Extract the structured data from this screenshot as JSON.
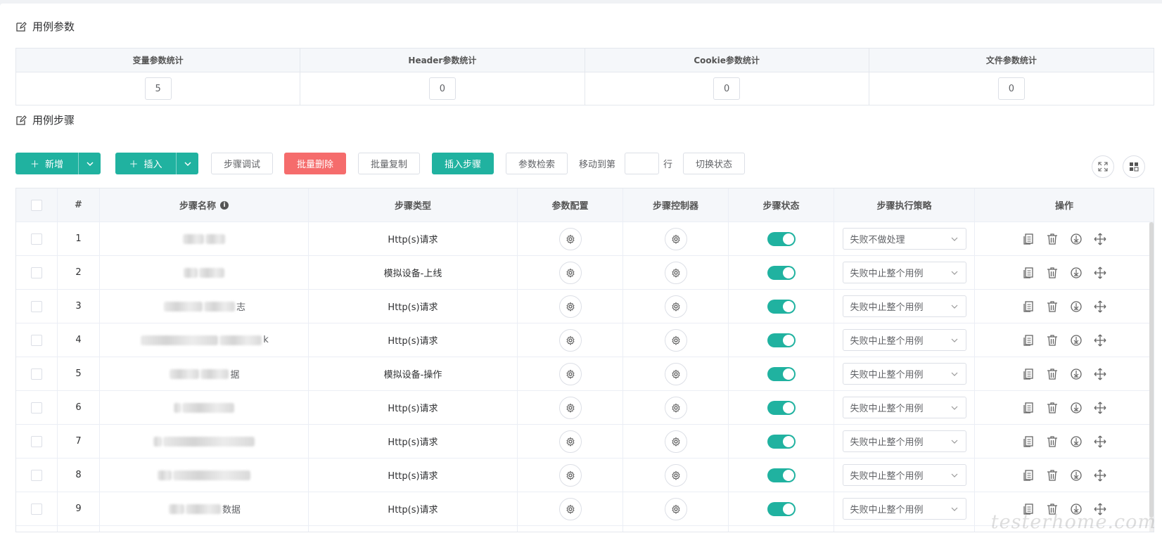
{
  "params_section": {
    "title": "用例参数"
  },
  "stats": [
    {
      "label": "变量参数统计",
      "value": "5"
    },
    {
      "label": "Header参数统计",
      "value": "0"
    },
    {
      "label": "Cookie参数统计",
      "value": "0"
    },
    {
      "label": "文件参数统计",
      "value": "0"
    }
  ],
  "steps_section": {
    "title": "用例步骤"
  },
  "toolbar": {
    "add_label": "新增",
    "insert_label": "插入",
    "debug_label": "步骤调试",
    "batch_delete_label": "批量删除",
    "batch_copy_label": "批量复制",
    "insert_step_label": "插入步骤",
    "param_search_label": "参数检索",
    "move_to_label": "移动到第",
    "row_label": "行",
    "toggle_status_label": "切换状态"
  },
  "table": {
    "headers": [
      "#",
      "步骤名称",
      "步骤类型",
      "参数配置",
      "步骤控制器",
      "步骤状态",
      "步骤执行策略",
      "操作"
    ],
    "rows": [
      {
        "index": "1",
        "name_prefix": "",
        "name_suffix": "",
        "type": "Http(s)请求",
        "enabled": true,
        "strategy": "失败不做处理"
      },
      {
        "index": "2",
        "name_prefix": "",
        "name_suffix": "",
        "type": "模拟设备-上线",
        "enabled": true,
        "strategy": "失败中止整个用例"
      },
      {
        "index": "3",
        "name_prefix": "",
        "name_suffix": "志",
        "type": "Http(s)请求",
        "enabled": true,
        "strategy": "失败中止整个用例"
      },
      {
        "index": "4",
        "name_prefix": "",
        "name_suffix": "k",
        "type": "Http(s)请求",
        "enabled": true,
        "strategy": "失败中止整个用例"
      },
      {
        "index": "5",
        "name_prefix": "",
        "name_suffix": "据",
        "type": "模拟设备-操作",
        "enabled": true,
        "strategy": "失败中止整个用例"
      },
      {
        "index": "6",
        "name_prefix": "",
        "name_suffix": "",
        "type": "Http(s)请求",
        "enabled": true,
        "strategy": "失败中止整个用例"
      },
      {
        "index": "7",
        "name_prefix": "",
        "name_suffix": "",
        "type": "Http(s)请求",
        "enabled": true,
        "strategy": "失败中止整个用例"
      },
      {
        "index": "8",
        "name_prefix": "",
        "name_suffix": "",
        "type": "Http(s)请求",
        "enabled": true,
        "strategy": "失败中止整个用例"
      },
      {
        "index": "9",
        "name_prefix": "",
        "name_suffix": "数据",
        "type": "Http(s)请求",
        "enabled": true,
        "strategy": "失败中止整个用例"
      }
    ]
  },
  "watermark": "testerhome.com",
  "colors": {
    "primary": "#20b2a0",
    "danger": "#f56c6c"
  }
}
